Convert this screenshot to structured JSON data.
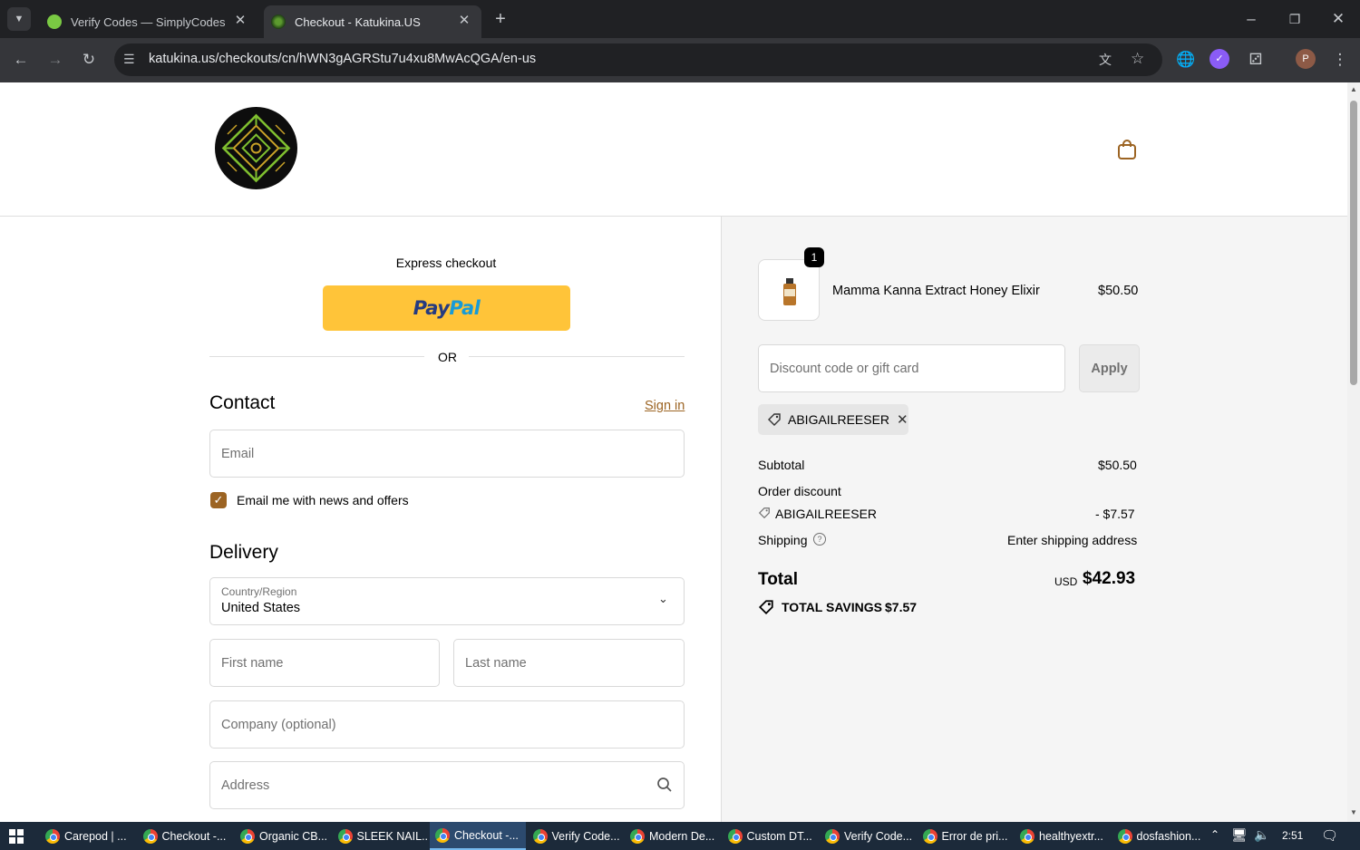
{
  "browser": {
    "tabs": [
      {
        "title": "Verify Codes — SimplyCodes",
        "active": false
      },
      {
        "title": "Checkout - Katukina.US",
        "active": true
      }
    ],
    "new_tab": "+",
    "url": "katukina.us/checkouts/cn/hWN3gAGRStu7u4xu8MwAcQGA/en-us",
    "profile_initial": "P",
    "window_controls": {
      "minimize": "–",
      "restore": "❐",
      "close": "✕"
    }
  },
  "checkout": {
    "express_label": "Express checkout",
    "paypal_label": "PayPal",
    "or_label": "OR",
    "contact": {
      "heading": "Contact",
      "sign_in": "Sign in",
      "email_placeholder": "Email",
      "newsletter_label": "Email me with news and offers",
      "newsletter_checked": true
    },
    "delivery": {
      "heading": "Delivery",
      "country_label": "Country/Region",
      "country_value": "United States",
      "first_name": "First name",
      "last_name": "Last name",
      "company": "Company (optional)",
      "address": "Address"
    }
  },
  "summary": {
    "item": {
      "qty": "1",
      "name": "Mamma Kanna Extract Honey Elixir",
      "price": "$50.50"
    },
    "discount_placeholder": "Discount code or gift card",
    "apply_label": "Apply",
    "applied_code": "ABIGAILREESER",
    "subtotal_label": "Subtotal",
    "subtotal_value": "$50.50",
    "order_discount_label": "Order discount",
    "discount_code": "ABIGAILREESER",
    "discount_value": "- $7.57",
    "shipping_label": "Shipping",
    "shipping_value": "Enter shipping address",
    "total_label": "Total",
    "currency": "USD",
    "total_value": "$42.93",
    "savings_label": "TOTAL SAVINGS",
    "savings_value": "$7.57"
  },
  "taskbar": {
    "items": [
      "Carepod | ...",
      "Checkout -...",
      "Organic CB...",
      "SLEEK NAIL...",
      "Checkout -...",
      "Verify Code...",
      "Modern De...",
      "Custom DT...",
      "Verify Code...",
      "Error de pri...",
      "healthyextr...",
      "dosfashion..."
    ],
    "clock": "2:51"
  },
  "colors": {
    "accent": "#9c6423",
    "paypal_yellow": "#ffc439",
    "paypal_dark": "#253b80",
    "paypal_light": "#179bd7"
  }
}
